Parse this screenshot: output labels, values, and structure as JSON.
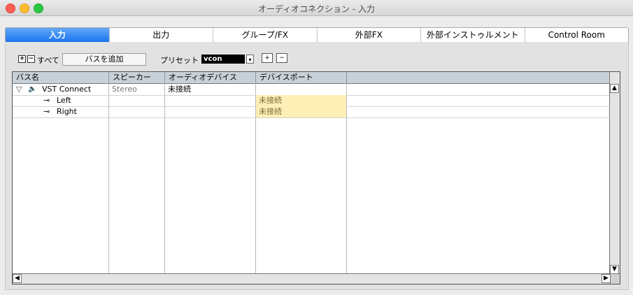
{
  "window": {
    "title": "オーディオコネクション - 入力"
  },
  "tabs": [
    {
      "label": "入力",
      "active": true
    },
    {
      "label": "出力"
    },
    {
      "label": "グループ/FX"
    },
    {
      "label": "外部FX"
    },
    {
      "label": "外部インストゥルメント"
    },
    {
      "label": "Control Room"
    }
  ],
  "toolbar": {
    "expand_icon": "+",
    "collapse_icon": "−",
    "all_label": "すべて",
    "add_bus_label": "バスを追加",
    "preset_label": "プリセット",
    "preset_value": "vcon",
    "dropdown_icon": "▾",
    "store_icon": "+",
    "remove_icon": "−"
  },
  "grid": {
    "columns": [
      "バス名",
      "スピーカー",
      "オーディオデバイス",
      "デバイスポート",
      ""
    ],
    "rows": [
      {
        "expander": "▽",
        "icon": "🔈",
        "name": "VST Connect",
        "speaker": "Stereo",
        "device": "未接続",
        "port": ""
      },
      {
        "icon": "⊸",
        "name": "Left",
        "speaker": "",
        "device": "",
        "port": "未接続"
      },
      {
        "icon": "⊸",
        "name": "Right",
        "speaker": "",
        "device": "",
        "port": "未接続"
      }
    ]
  },
  "scroll": {
    "up": "▲",
    "down": "▼",
    "left": "◀",
    "right": "▶"
  },
  "colors": {
    "tab_active": "#1b74ee",
    "unconnected_bg": "#fdf0b6",
    "header_bg": "#c9d1d8"
  }
}
